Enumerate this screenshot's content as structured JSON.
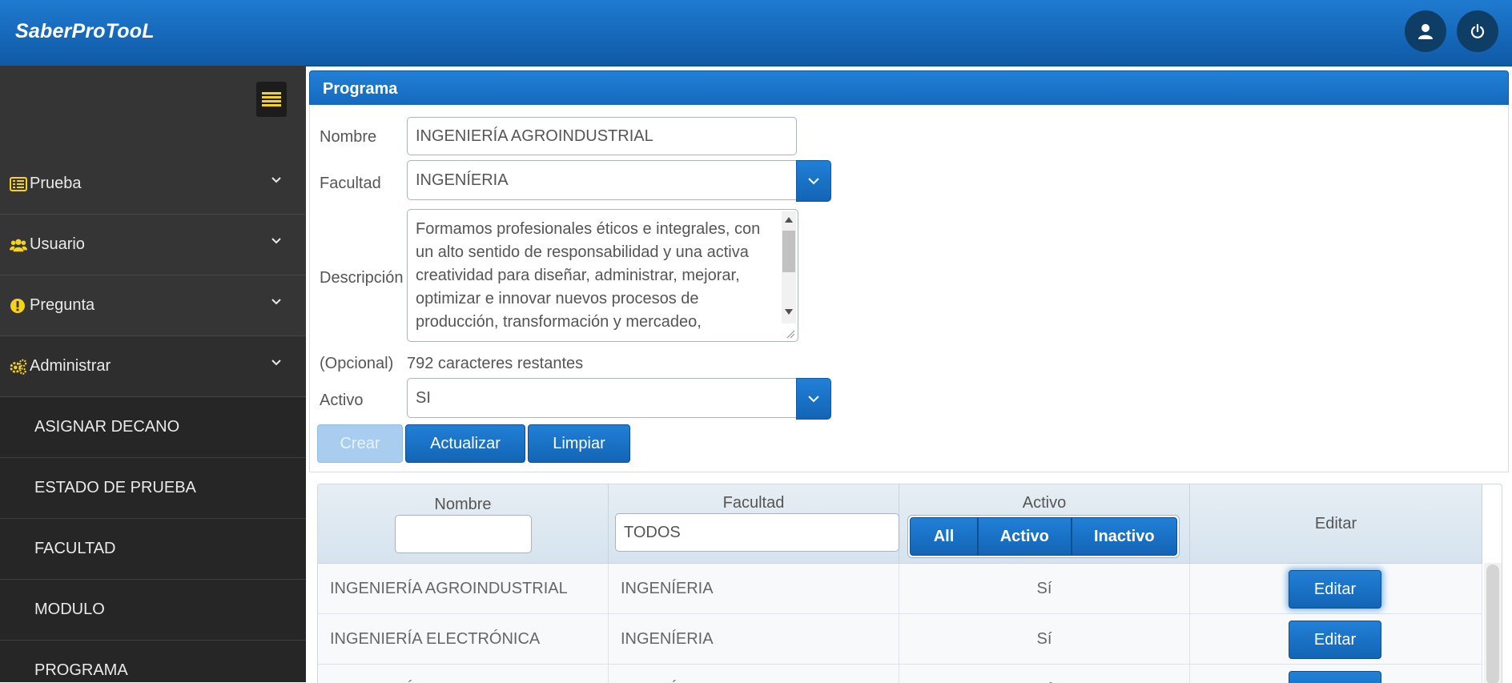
{
  "app": {
    "brand": "SaberProTooL"
  },
  "header": {
    "user_icon": "user-icon",
    "power_icon": "power-icon"
  },
  "sidebar": {
    "toggle_icon": "menu-lines-icon",
    "items": [
      {
        "label": "Prueba",
        "icon": "list-icon"
      },
      {
        "label": "Usuario",
        "icon": "users-icon"
      },
      {
        "label": "Pregunta",
        "icon": "exclamation-circle-icon"
      },
      {
        "label": "Administrar",
        "icon": "gears-icon"
      }
    ],
    "subitems": [
      "ASIGNAR DECANO",
      "ESTADO DE PRUEBA",
      "FACULTAD",
      "MODULO",
      "PROGRAMA"
    ]
  },
  "form": {
    "panel_title": "Programa",
    "nombre_label": "Nombre",
    "nombre_value": "INGENIERÍA AGROINDUSTRIAL",
    "facultad_label": "Facultad",
    "facultad_value": "INGENÍERIA",
    "descripcion_label": "Descripción",
    "descripcion_value": "Formamos profesionales éticos e integrales, con un alto sentido de responsabilidad y una activa creatividad para diseñar, administrar, mejorar, optimizar e innovar nuevos procesos de producción, transformación y mercadeo,",
    "opcional_label": "(Opcional)",
    "chars_remaining": "792 caracteres restantes",
    "activo_label": "Activo",
    "activo_value": "SI",
    "buttons": {
      "crear": "Crear",
      "actualizar": "Actualizar",
      "limpiar": "Limpiar"
    }
  },
  "table": {
    "headers": {
      "nombre": "Nombre",
      "facultad": "Facultad",
      "activo": "Activo",
      "editar": "Editar"
    },
    "filters": {
      "nombre_value": "",
      "facultad_value": "TODOS",
      "activo_options": [
        "All",
        "Activo",
        "Inactivo"
      ]
    },
    "rows": [
      {
        "nombre": "INGENIERÍA AGROINDUSTRIAL",
        "facultad": "INGENÍERIA",
        "activo": "Sí",
        "editar": "Editar"
      },
      {
        "nombre": "INGENIERÍA ELECTRÓNICA",
        "facultad": "INGENÍERIA",
        "activo": "Sí",
        "editar": "Editar"
      },
      {
        "nombre": "INGENIERÍA INDUSTRIAL",
        "facultad": "INGENÍERIA",
        "activo": "Sí",
        "editar": "Editar"
      }
    ]
  },
  "colors": {
    "primary": "#1566b7",
    "sidebar": "#353535",
    "icon_accent": "#f7d21a",
    "power_bg": "#0e3e66"
  }
}
